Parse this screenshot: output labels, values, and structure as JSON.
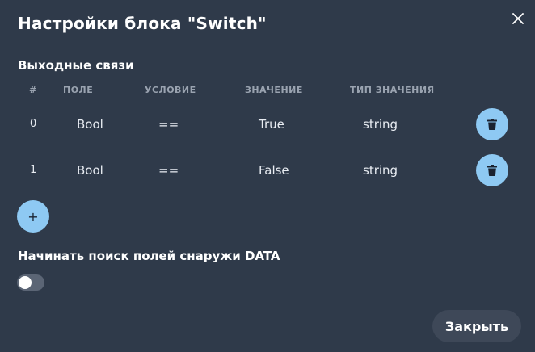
{
  "dialog": {
    "title": "Настройки блока \"Switch\"",
    "close_icon": "close-icon"
  },
  "outputs": {
    "section_title": "Выходные связи",
    "columns": [
      "#",
      "ПОЛЕ",
      "УСЛОВИЕ",
      "ЗНАЧЕНИЕ",
      "ТИП ЗНАЧЕНИЯ"
    ],
    "rows": [
      {
        "index": "0",
        "field": "Bool",
        "condition": "==",
        "value": "True",
        "type": "string"
      },
      {
        "index": "1",
        "field": "Bool",
        "condition": "==",
        "value": "False",
        "type": "string"
      }
    ],
    "delete_icon": "trash-icon",
    "add_label": "+"
  },
  "search": {
    "label": "Начинать поиск полей снаружи DATA",
    "toggle_on": false
  },
  "footer": {
    "close_label": "Закрыть"
  },
  "colors": {
    "background": "#2f3a4a",
    "accent": "#8ec9f3",
    "header_text": "#9aa3b0",
    "button_bg": "#3e4858"
  }
}
